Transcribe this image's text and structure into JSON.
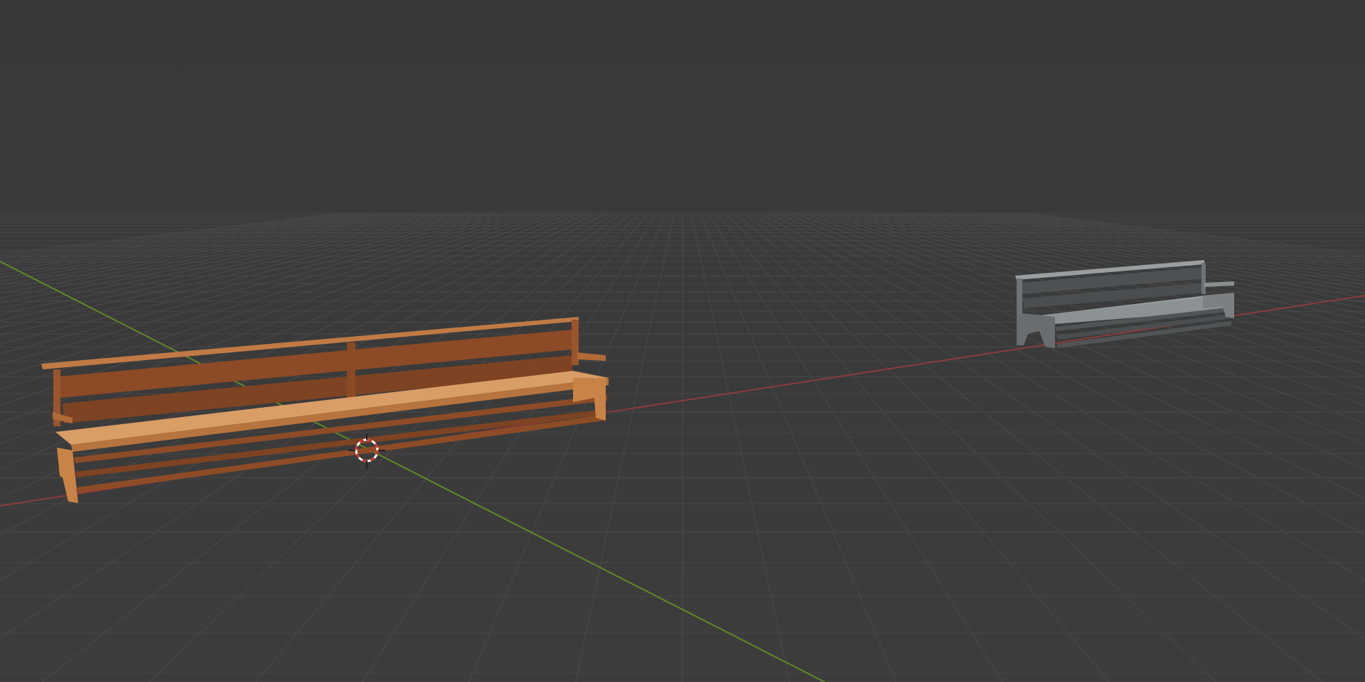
{
  "viewport": {
    "name": "3D Viewport",
    "background_color": "#393939",
    "grid_color": "#4a4a4a",
    "x_axis_color": "#8c3a3a",
    "y_axis_color": "#5f8a26"
  },
  "objects": [
    {
      "name": "wooden-bench",
      "material": "wood",
      "color": "#b86f3a"
    },
    {
      "name": "grey-bench",
      "material": "untextured",
      "color": "#8e9294"
    }
  ],
  "cursor": {
    "name": "3d-cursor",
    "colors": [
      "#d03030",
      "#ffffff"
    ]
  }
}
